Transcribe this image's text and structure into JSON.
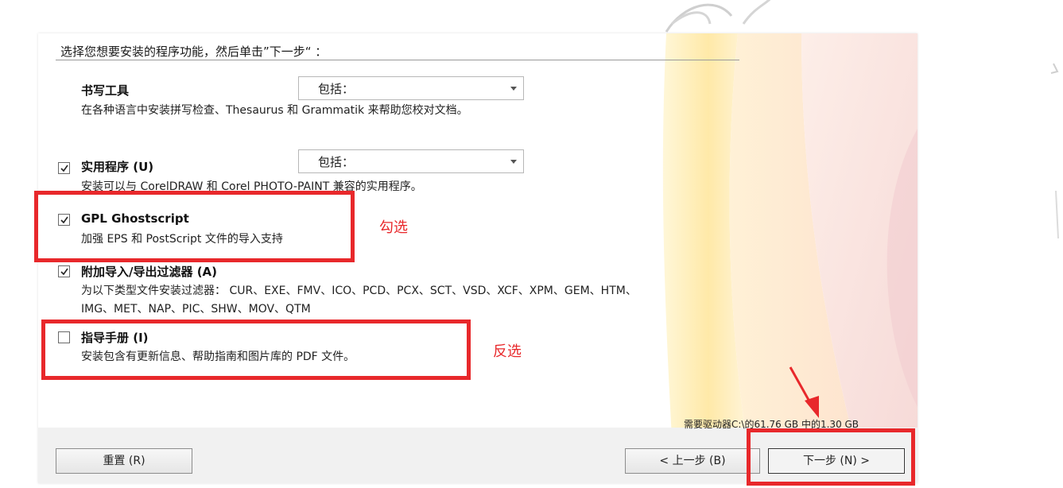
{
  "header": {
    "instruction": "选择您想要安装的程序功能，然后单击”下一步“ ："
  },
  "features": {
    "writing_tools": {
      "title": "书写工具",
      "description": "在各种语言中安装拼写检查、Thesaurus 和  Grammatik 来帮助您校对文档。",
      "option": "包括："
    },
    "utilities": {
      "title": "实用程序 (U)",
      "description": "安装可以与  CorelDRAW 和  Corel PHOTO-PAINT 兼容的实用程序。",
      "option": "包括：",
      "checked": true
    },
    "ghostscript": {
      "title": "GPL Ghostscript",
      "description": "加强  EPS 和  PostScript 文件的导入支持",
      "checked": true
    },
    "filters": {
      "title": "附加导入/导出过滤器 (A)",
      "description_line1": "为以下类型文件安装过滤器：  CUR、EXE、FMV、ICO、PCD、PCX、SCT、VSD、XCF、XPM、GEM、HTM、",
      "description_line2": "IMG、MET、NAP、PIC、SHW、MOV、QTM",
      "checked": true
    },
    "guide": {
      "title": "指导手册 (I)",
      "description": "安装包含有更新信息、帮助指南和图片库的  PDF 文件。",
      "checked": false
    }
  },
  "annotations": {
    "check": "勾选",
    "uncheck": "反选",
    "accent_color": "#e8282b"
  },
  "disk_space": "需要驱动器C:\\的61.76 GB 中的1.30 GB",
  "buttons": {
    "reset": "重置 (R)",
    "back": "< 上一步 (B)",
    "next": "下一步 (N) >"
  }
}
